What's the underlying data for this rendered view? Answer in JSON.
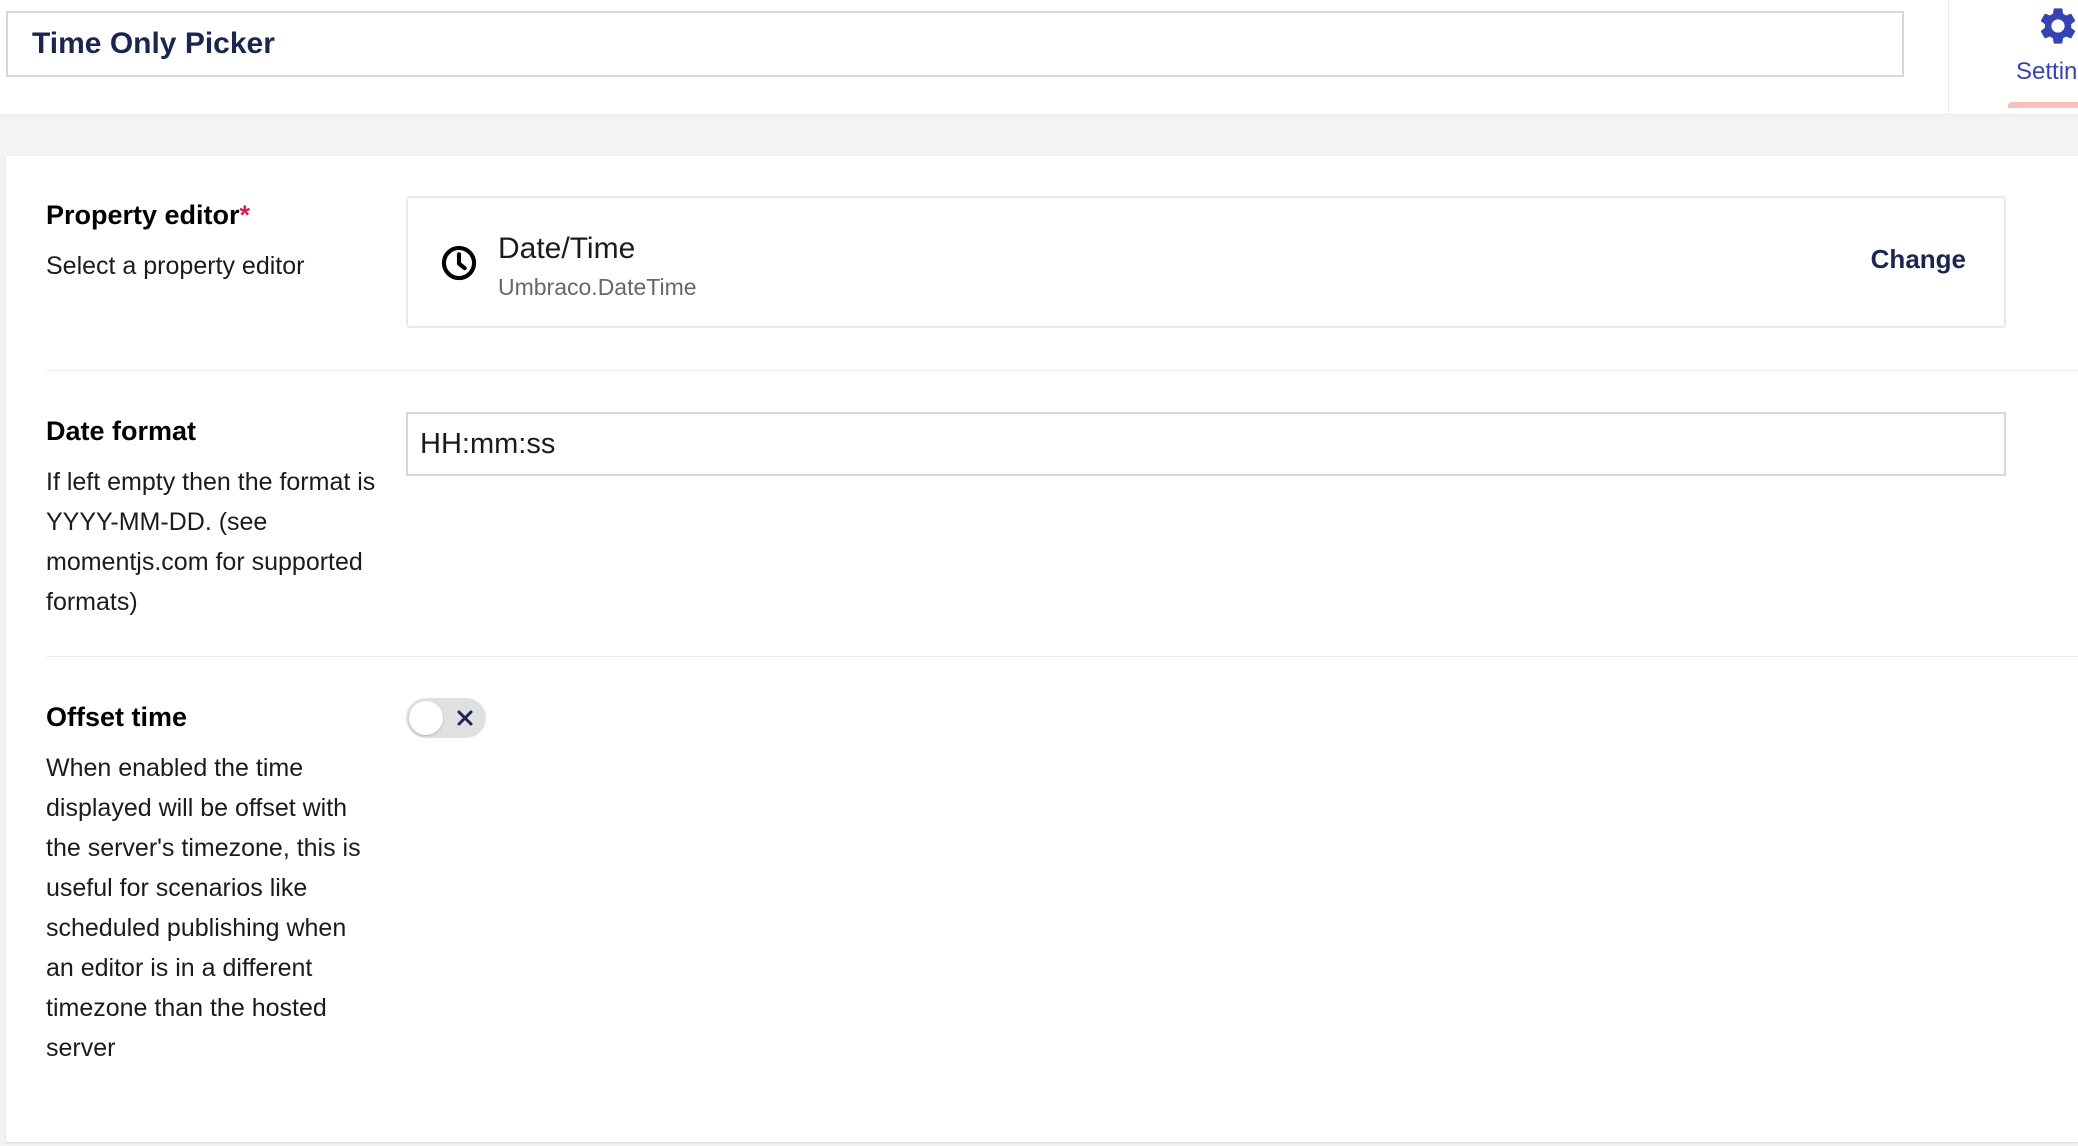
{
  "header": {
    "name_value": "Time Only Picker",
    "settings_tab_label": "Settin"
  },
  "property_editor": {
    "label": "Property editor",
    "required_marker": "*",
    "description": "Select a property editor",
    "editor_name": "Date/Time",
    "editor_alias": "Umbraco.DateTime",
    "editor_icon": "clock-icon",
    "change_label": "Change"
  },
  "date_format": {
    "label": "Date format",
    "description": "If left empty then the format is YYYY-MM-DD. (see momentjs.com for supported formats)",
    "value": "HH:mm:ss"
  },
  "offset_time": {
    "label": "Offset time",
    "description": "When enabled the time displayed will be offset with the server's timezone, this is useful for scenarios like scheduled publishing when an editor is in a different timezone than the hosted server",
    "enabled": false
  },
  "colors": {
    "accent": "#3544b1",
    "text": "#1b264f",
    "required": "#d42054",
    "active_tab_indicator": "#f5c1bc"
  }
}
